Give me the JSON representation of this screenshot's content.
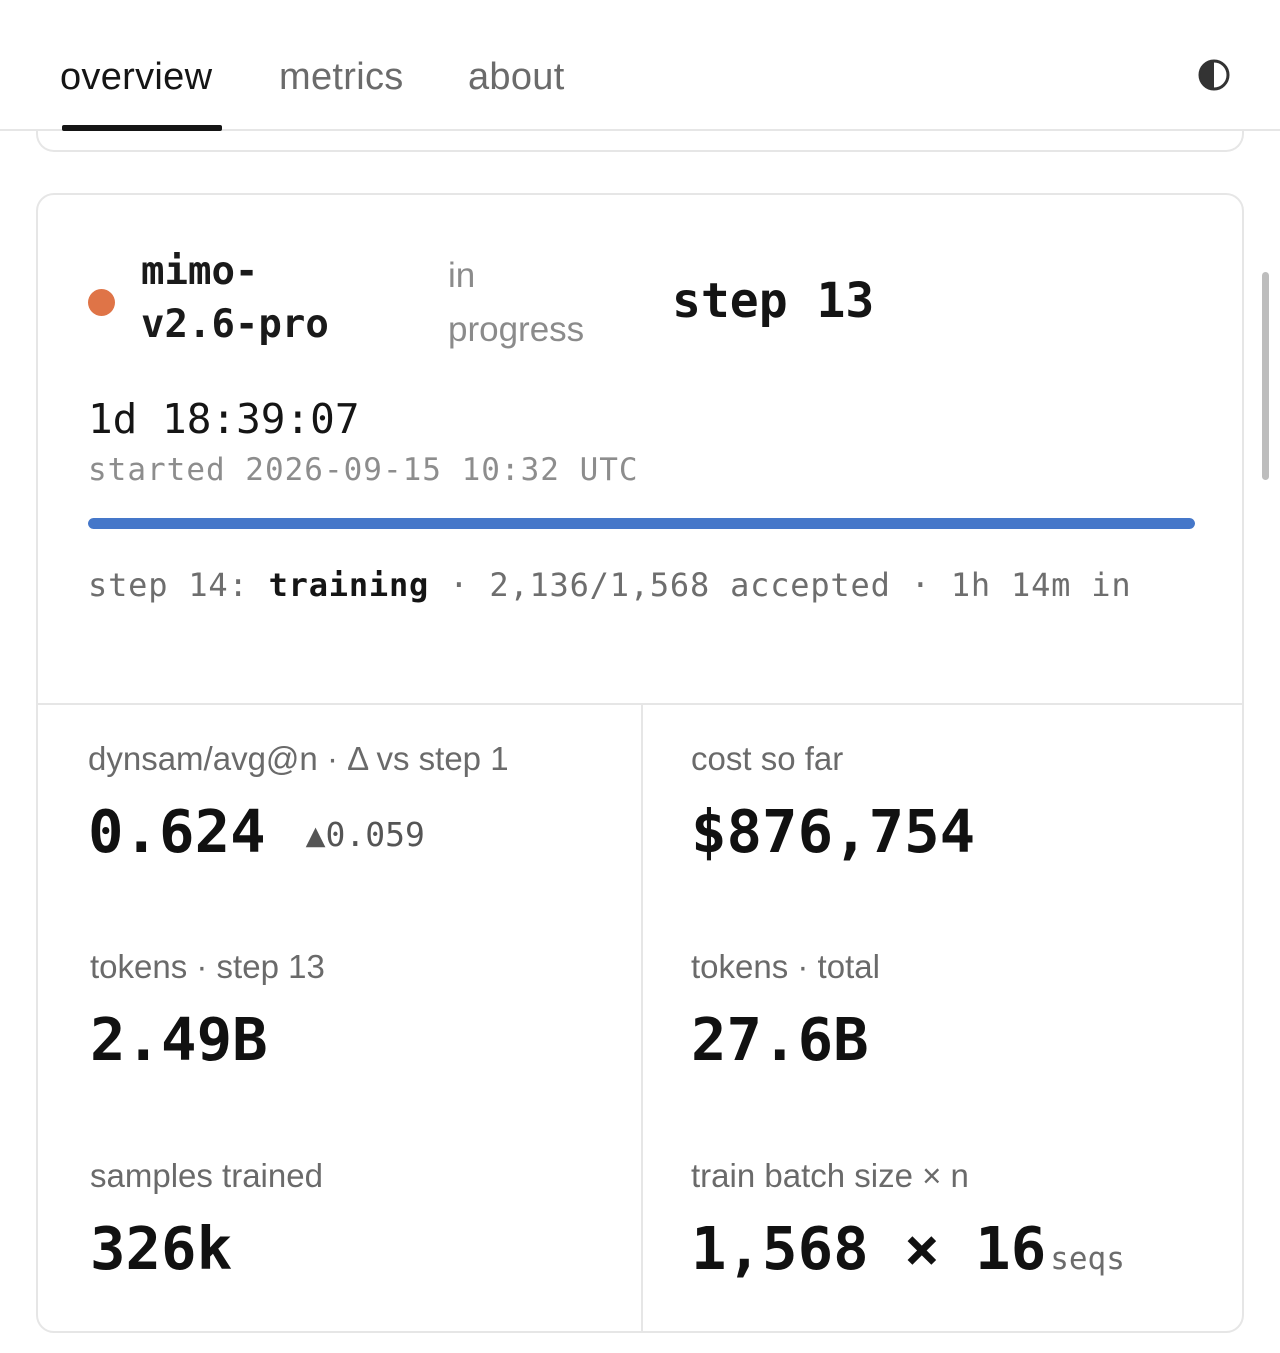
{
  "tabs": [
    {
      "label": "overview",
      "active": true
    },
    {
      "label": "metrics",
      "active": false
    },
    {
      "label": "about",
      "active": false
    }
  ],
  "theme_toggle_icon": "half-circle-contrast-icon",
  "run": {
    "name_lines": [
      "mimo-",
      "v2.6-pro"
    ],
    "status_lines": [
      "in",
      "progress"
    ],
    "status_color": "#df7447",
    "step": "step 13",
    "elapsed": "1d 18:39:07",
    "started": "started 2026-09-15 10:32 UTC",
    "progress_fraction": 1.0,
    "progress_color": "#4577c9",
    "current_step": {
      "prefix": "step 14: ",
      "phase": "training",
      "details": " · 2,136/1,568 accepted · 1h 14m in"
    }
  },
  "metrics": [
    {
      "label": "dynsam/avg@n · Δ vs step 1",
      "value": "0.624",
      "delta": "▲0.059"
    },
    {
      "label": "cost so far",
      "value": "$876,754"
    },
    {
      "label": "tokens · step 13",
      "value": "2.49B"
    },
    {
      "label": "tokens · total",
      "value": "27.6B"
    },
    {
      "label": "samples trained",
      "value": "326k"
    },
    {
      "label": "train batch size × n",
      "value": "1,568 × 16",
      "unit": "seqs"
    }
  ]
}
